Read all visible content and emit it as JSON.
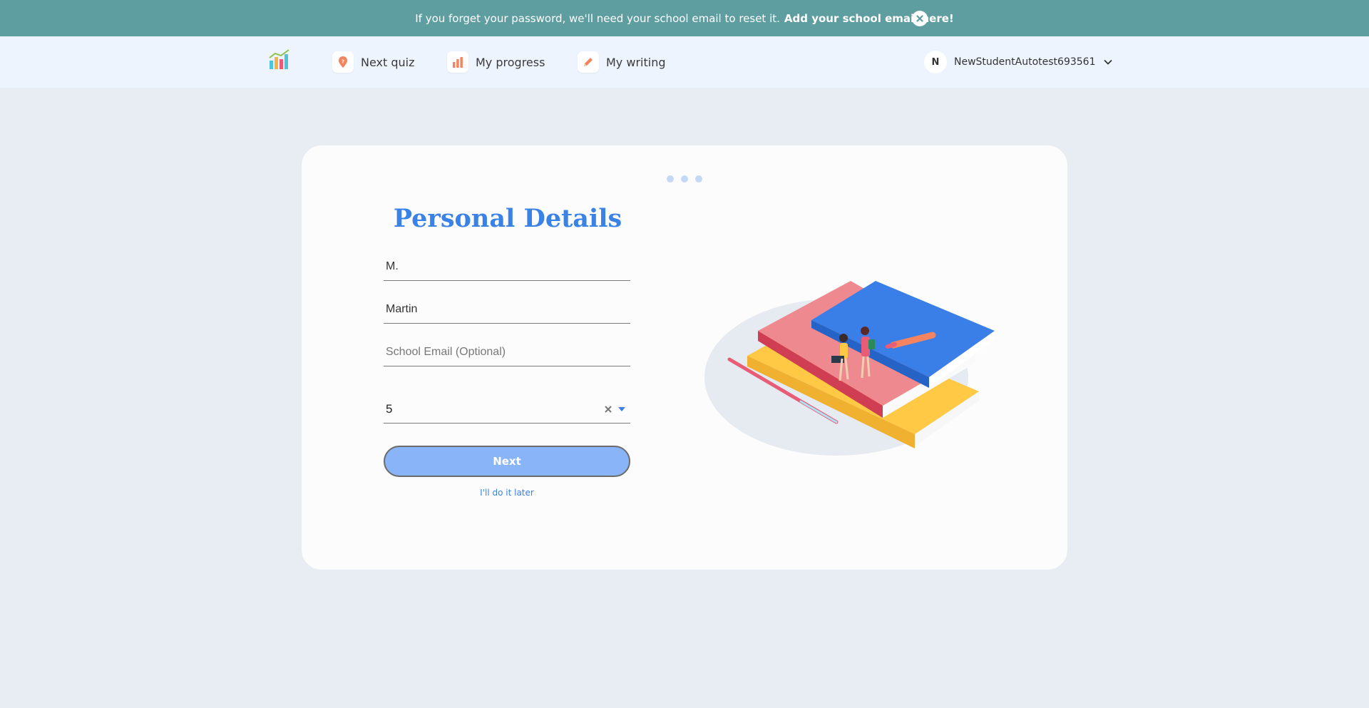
{
  "banner": {
    "message": "If you forget your password, we'll need your school email to reset it.",
    "link": "Add your school email here!"
  },
  "nav": {
    "items": [
      {
        "label": "Next quiz",
        "icon": "quiz-pin-icon"
      },
      {
        "label": "My progress",
        "icon": "bar-chart-icon"
      },
      {
        "label": "My writing",
        "icon": "pencil-icon"
      }
    ],
    "user": {
      "initial": "N",
      "name": "NewStudentAutotest693561"
    }
  },
  "form": {
    "title": "Personal Details",
    "first_name": "M.",
    "last_name": "Martin",
    "email_placeholder": "School Email (Optional)",
    "email_value": "",
    "grade": "5",
    "next_label": "Next",
    "later_label": "I'll do it later"
  },
  "progress_steps": 3,
  "colors": {
    "banner": "#5f9ea0",
    "accent": "#3b82e6",
    "button": "#8ab4f8",
    "page": "#e8edf4"
  }
}
